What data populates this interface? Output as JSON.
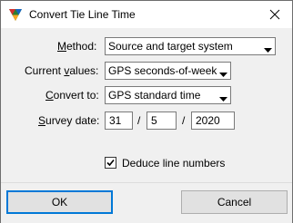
{
  "window": {
    "title": "Convert Tie Line Time"
  },
  "form": {
    "method": {
      "label_pre": "",
      "label_ul": "M",
      "label_post": "ethod:",
      "value": "Source and target system"
    },
    "current": {
      "label_pre": "Current ",
      "label_ul": "v",
      "label_post": "alues:",
      "value": "GPS seconds-of-week"
    },
    "convert": {
      "label_pre": "",
      "label_ul": "C",
      "label_post": "onvert to:",
      "value": "GPS standard time"
    },
    "survey_date": {
      "label_pre": "",
      "label_ul": "S",
      "label_post": "urvey date:",
      "day": "31",
      "month": "5",
      "year": "2020",
      "separator": "/"
    }
  },
  "options": {
    "deduce_line_numbers": {
      "label": "Deduce line numbers",
      "checked": true
    }
  },
  "buttons": {
    "ok": "OK",
    "cancel": "Cancel"
  },
  "colors": {
    "focus_border": "#0078d7"
  }
}
